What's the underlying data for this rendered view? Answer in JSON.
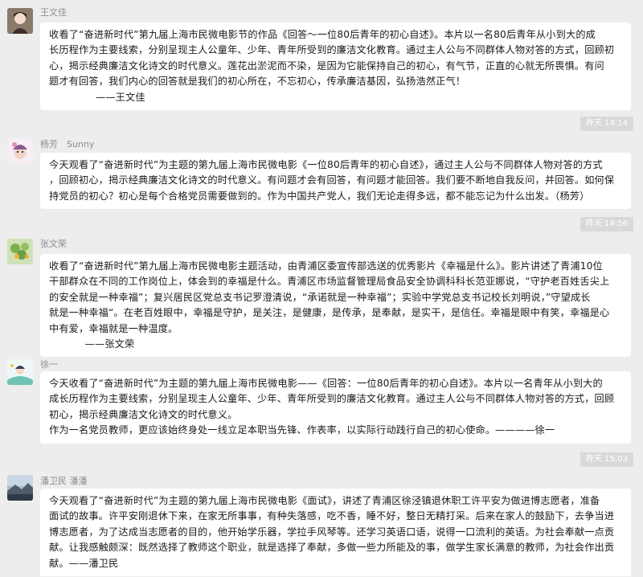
{
  "messages": [
    {
      "sender": "王文佳",
      "avatar": "photo-avatar",
      "lines": [
        "收看了“奋进新时代”第九届上海市民微电影节的作品《回答～一位80后青年的初心自述》。本片以一名80后青年从小到大的成",
        "长历程作为主要线索，分别呈现主人公童年、少年、青年所受到的廉洁文化教育。通过主人公与不同群体人物对答的方式，回顾初",
        "心，揭示经典廉洁文化诗文的时代意义。莲花出淤泥而不染，是因为它能保持自己的初心，有气节，正直的心就无所畏惧。有问",
        "题才有回答，我们内心的回答就是我们的初心所在，不忘初心，传承廉洁基因，弘扬浩然正气！"
      ],
      "signature": "——王文佳",
      "time_after": "昨天 14:14"
    },
    {
      "sender": "杨芳　Sunny",
      "avatar": "cartoon-avatar",
      "lines": [
        "今天观看了“奋进新时代”为主题的第九届上海市民微电影《一位80后青年的初心自述》，通过主人公与不同群体人物对答的方式",
        "，回顾初心，揭示经典廉洁文化诗文的时代意义。有问题才会有回答，有问题才能回答。我们要不断地自我反问，并回答。如何保",
        "持党员的初心？初心是每个合格党员需要做到的。作为中国共产党人，我们无论走得多远，都不能忘记为什么出发。（杨芳）"
      ],
      "signature": "",
      "time_after": "昨天 14:56"
    },
    {
      "sender": "张文荣",
      "avatar": "flower-avatar",
      "lines": [
        "收看了“奋进新时代”第九届上海市民微电影主题活动，由青浦区委宣传部选送的优秀影片《幸福是什么》。影片讲述了青浦10位",
        "干部群众在不同的工作岗位上，体会到的幸福是什么。青浦区市场监督管理局食品安全协调科科长范亚娜说，“守护老百姓舌尖上",
        "的安全就是一种幸福”；复兴居民区党总支书记罗澄清说，“承诺就是一种幸福”；实验中学党总支书记校长刘明说，”守望成长",
        "就是一种幸福“。在老百姓眼中，幸福是守护，是关注，是健康，是传承，是奉献，是实干，是信任。幸福是眼中有笑，幸福是心",
        "中有爱，幸福就是一种温度。"
      ],
      "signature": "　　——张文荣",
      "time_after": ""
    },
    {
      "sender": "徐一",
      "avatar": "illustration-avatar",
      "lines": [
        "今天收看了“奋进新时代”为主题的第九届上海市民微电影——《回答：一位80后青年的初心自述》。本片以一名青年从小到大的",
        "成长历程作为主要线索，分别呈现主人公童年、少年、青年所受到的廉洁文化教育。通过主人公与不同群体人物对答的方式，回顾",
        "初心，揭示经典廉洁文化诗文的时代意义。",
        "作为一名党员教师，更应该始终身处一线立足本职当先锋、作表率，以实际行动践行自己的初心使命。————徐一"
      ],
      "signature": "",
      "time_after": "昨天 15:03"
    },
    {
      "sender": "潘卫民 潘潘",
      "avatar": "landscape-avatar",
      "lines": [
        "今天观看了“奋进新时代”为主题的第九届上海市民微电影《面试》，讲述了青浦区徐泾镇退休职工许平安为做进博志愿者，准备",
        "面试的故事。许平安刚退休下来，在家无所事事，有种失落感，吃不香，睡不好，整日无精打采。后来在家人的鼓励下，去争当进",
        "博志愿者，为了达成当志愿者的目的，他开始学乐器，学拉手风琴等。还学习英语口语，说得一口流利的英语。为社会奉献一点贡",
        "献。让我感触颇深：既然选择了教师这个职业，就是选择了奉献，多做一些力所能及的事，做学生家长满意的教师，为社会作出贡",
        "献。——潘卫民"
      ],
      "signature": "",
      "time_after": ""
    }
  ]
}
